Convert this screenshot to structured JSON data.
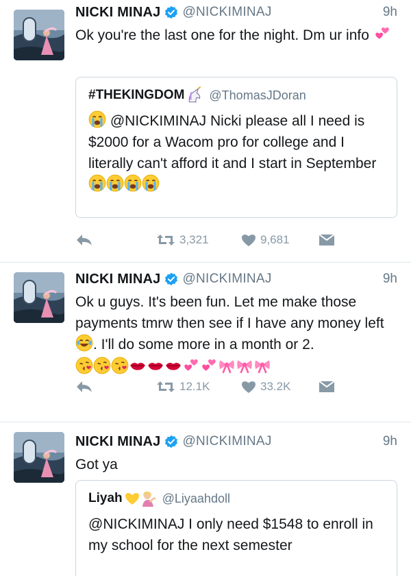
{
  "tweets": [
    {
      "author": "NICKI MINAJ",
      "handle": "@NICKIMINAJ",
      "time": "9h",
      "text": "Ok you're the last one for the night. Dm ur info",
      "quote": {
        "name": "#THEKINGDOM",
        "handle": "@ThomasJDoran",
        "text": "@NICKIMINAJ Nicki please all I need is $2000 for a Wacom pro for college and I literally can't afford it and I start in September"
      },
      "retweets": "3,321",
      "likes": "9,681"
    },
    {
      "author": "NICKI MINAJ",
      "handle": "@NICKIMINAJ",
      "time": "9h",
      "text_a": "Ok u guys. It's been fun. Let me make those payments tmrw then see if I have any money left",
      "text_b": ". I'll do some more in a month or 2.",
      "retweets": "12.1K",
      "likes": "33.2K"
    },
    {
      "author": "NICKI MINAJ",
      "handle": "@NICKIMINAJ",
      "time": "9h",
      "text": "Got ya",
      "quote": {
        "name": "Liyah",
        "handle": "@Liyaahdoll",
        "text": "@NICKIMINAJ I only need $1548 to enroll in my school for the next semester"
      }
    }
  ],
  "icons": {
    "reply": "reply-icon",
    "retweet": "retweet-icon",
    "like": "heart-icon",
    "dm": "envelope-icon",
    "verified": "verified-badge-icon"
  },
  "colors": {
    "verified": "#1da1f2",
    "muted": "#657786",
    "action": "#8899a6"
  }
}
